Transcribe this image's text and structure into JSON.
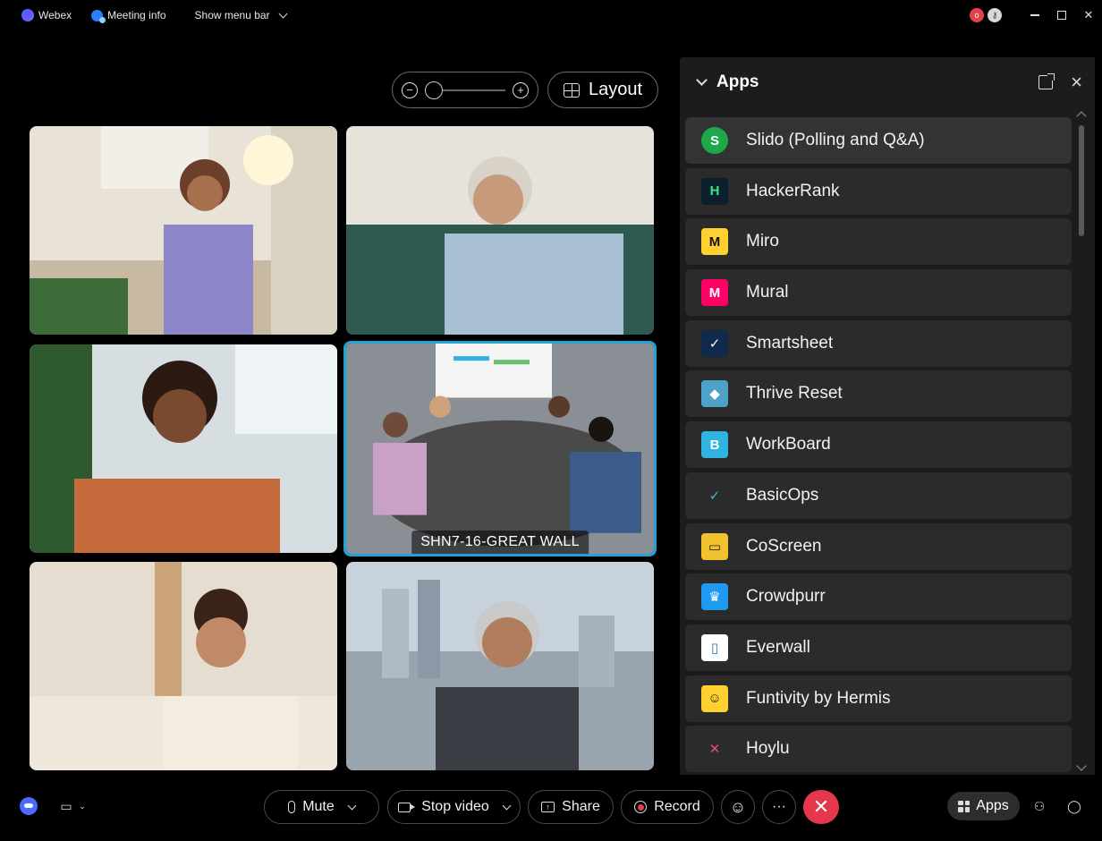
{
  "titlebar": {
    "app_name": "Webex",
    "meeting_info": "Meeting info",
    "show_menu_bar": "Show menu bar",
    "rec_badge": "o"
  },
  "stage": {
    "layout_label": "Layout",
    "zoom_out": "−",
    "zoom_in": "+",
    "active_tile_label": "SHN7-16-GREAT WALL"
  },
  "apps_panel": {
    "title": "Apps",
    "close": "×",
    "items": [
      {
        "label": "Slido (Polling and Q&A)",
        "icon": "slido-icon",
        "glyph": "S",
        "bg": "#1fa84a",
        "fg": "#fff"
      },
      {
        "label": "HackerRank",
        "icon": "hackerrank-icon",
        "glyph": "H",
        "bg": "#0b1f2d",
        "fg": "#39e58c"
      },
      {
        "label": "Miro",
        "icon": "miro-icon",
        "glyph": "M",
        "bg": "#ffd02f",
        "fg": "#111"
      },
      {
        "label": "Mural",
        "icon": "mural-icon",
        "glyph": "M",
        "bg": "#ff0066",
        "fg": "#fff"
      },
      {
        "label": "Smartsheet",
        "icon": "smartsheet-icon",
        "glyph": "✓",
        "bg": "#0f2a4a",
        "fg": "#fff"
      },
      {
        "label": "Thrive Reset",
        "icon": "thrive-reset-icon",
        "glyph": "◆",
        "bg": "#4da3c7",
        "fg": "#fff"
      },
      {
        "label": "WorkBoard",
        "icon": "workboard-icon",
        "glyph": "B",
        "bg": "#2fb3e0",
        "fg": "#fff"
      },
      {
        "label": "BasicOps",
        "icon": "basicops-icon",
        "glyph": "✓",
        "bg": "#2b2b2b",
        "fg": "#3ac0d8"
      },
      {
        "label": "CoScreen",
        "icon": "coscreen-icon",
        "glyph": "▭",
        "bg": "#f2c12e",
        "fg": "#222"
      },
      {
        "label": "Crowdpurr",
        "icon": "crowdpurr-icon",
        "glyph": "♛",
        "bg": "#1e9bf0",
        "fg": "#fff"
      },
      {
        "label": "Everwall",
        "icon": "everwall-icon",
        "glyph": "▯",
        "bg": "#ffffff",
        "fg": "#2a7ab8"
      },
      {
        "label": "Funtivity by Hermis",
        "icon": "funtivity-icon",
        "glyph": "☺",
        "bg": "#ffd02f",
        "fg": "#222"
      },
      {
        "label": "Hoylu",
        "icon": "hoylu-icon",
        "glyph": "✕",
        "bg": "#2b2b2b",
        "fg": "#e8506a"
      }
    ]
  },
  "controls": {
    "mute": "Mute",
    "stop_video": "Stop video",
    "share": "Share",
    "record": "Record",
    "more": "···",
    "end": "✕",
    "apps": "Apps"
  },
  "colors": {
    "active_border": "#1fa3d6",
    "end_call": "#e5374b",
    "record_dot": "#e5404b"
  }
}
